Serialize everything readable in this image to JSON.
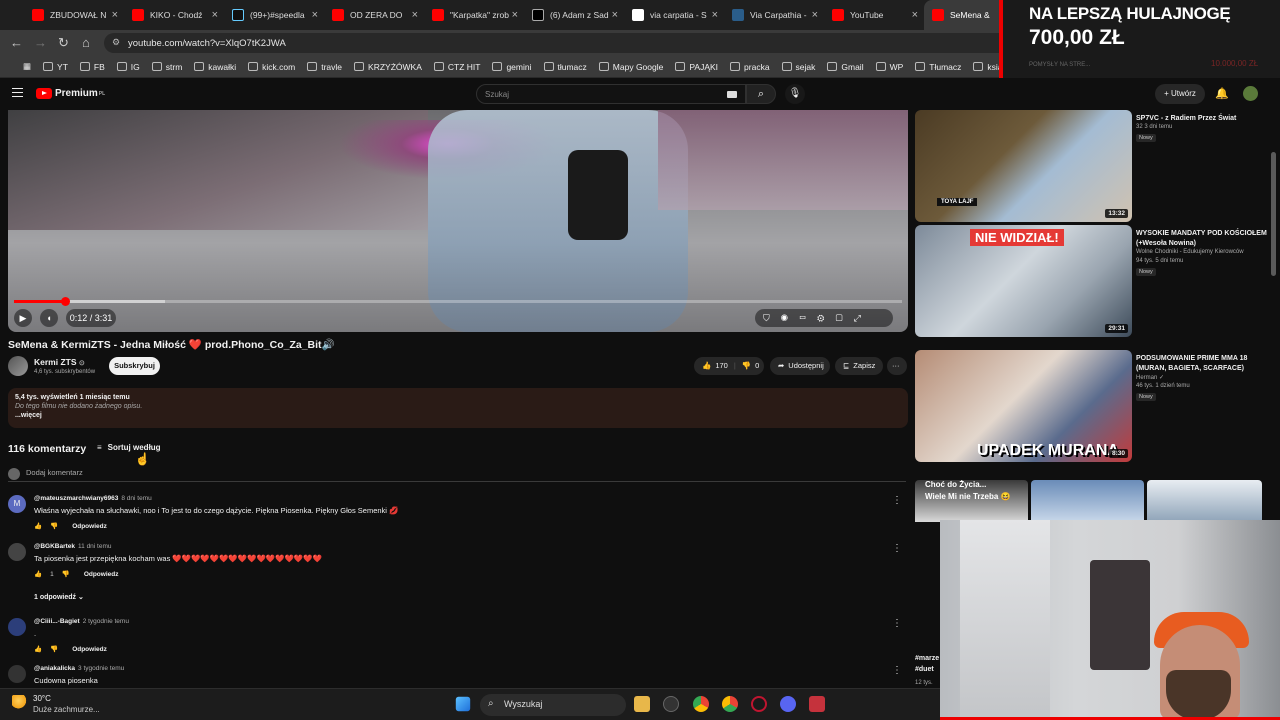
{
  "browser": {
    "tabs": [
      {
        "label": "ZBUDOWAŁ N",
        "icon": "youtube"
      },
      {
        "label": "KIKO - Chodź",
        "icon": "youtube"
      },
      {
        "label": "(99+)#speedla",
        "icon": "tiktok"
      },
      {
        "label": "OD ZERA DO",
        "icon": "youtube"
      },
      {
        "label": "\"Karpatka\" zrob",
        "icon": "youtube"
      },
      {
        "label": "(6) Adam z Sad",
        "icon": "x"
      },
      {
        "label": "via carpatia - S",
        "icon": "google"
      },
      {
        "label": "Via Carpathia -",
        "icon": "globe"
      },
      {
        "label": "YouTube",
        "icon": "youtube"
      },
      {
        "label": "SeMena &",
        "icon": "youtube",
        "active": true
      }
    ],
    "url": "youtube.com/watch?v=XlqO7tK2JWA",
    "bookmarks": [
      "YT",
      "FB",
      "IG",
      "strm",
      "kawałki",
      "kick.com",
      "travle",
      "KRZYŻÓWKA",
      "CTZ HIT",
      "gemini",
      "tłumacz",
      "Mapy Google",
      "PAJĄKI",
      "pracka",
      "sejak",
      "Gmail",
      "WP",
      "Tłumacz",
      "ksiazka"
    ],
    "bookmark_overflow": "POMYSŁY NA STRE..."
  },
  "overlay_ad": {
    "line1": "NA LEPSZĄ HULAJNOGĘ",
    "line2": "700,00 ZŁ",
    "faint_amount": "10.000,00 ZŁ"
  },
  "youtube": {
    "logo": "Premium",
    "logo_region": "PL",
    "search_placeholder": "Szukaj",
    "create_label": "Utwórz"
  },
  "video": {
    "time_current": "0:12",
    "time_total": "3:31",
    "time_display": "0:12 / 3:31",
    "progress_fraction": 0.057,
    "buffer_fraction": 0.17,
    "title": "SeMena & KermiZTS - Jedna Miłość ❤️ prod.Phono_Co_Za_Bit🔊",
    "channel": "Kermi ZTS",
    "subscribers": "4,6 tys. subskrybentów",
    "subscribe_label": "Subskrybuj",
    "likes": "170",
    "dislikes": "0",
    "share_label": "Udostępnij",
    "save_label": "Zapisz",
    "views_meta": "5,4 tys. wyświetleń  1 miesiąc temu",
    "no_description": "Do tego filmu nie dodano żadnego opisu.",
    "more_label": "...więcej"
  },
  "comments": {
    "count_label": "116 komentarzy",
    "sort_label": "Sortuj według",
    "add_placeholder": "Dodaj komentarz",
    "reply_label": "Odpowiedz",
    "items": [
      {
        "author": "@mateuszmarchwiany6963",
        "time": "8 dni temu",
        "text": "Właśna wyjechała na słuchawki, noo i To jest to do czego dążycie. Piękna Piosenka. Piękny Głos Semenki 💋",
        "likes": "",
        "avatar_letter": "M",
        "avatar_color": "#5c6bc0"
      },
      {
        "author": "@BGKBartek",
        "time": "11 dni temu",
        "text": "Ta piosenka jest przepiękna kocham was ❤️❤️❤️❤️❤️❤️❤️❤️❤️❤️❤️❤️❤️❤️❤️❤️",
        "likes": "1",
        "avatar_letter": "",
        "avatar_color": "#444444",
        "replies": "1 odpowiedź"
      },
      {
        "author": "@Ciiii...-Bagiet",
        "time": "2 tygodnie temu",
        "text": ".",
        "likes": "",
        "avatar_letter": "",
        "avatar_color": "#2c3e7a"
      },
      {
        "author": "@aniakalicka",
        "time": "3 tygodnie temu",
        "text": "Cudowna piosenka",
        "likes": "",
        "avatar_letter": "",
        "avatar_color": "#333333"
      }
    ]
  },
  "sidebar": {
    "items": [
      {
        "title": "SP7VC - z Radiem Przez Świat",
        "channel": "",
        "views": "32  3 dni temu",
        "badge": "Nowy",
        "duration": "13:32",
        "thumb_text": "TOYA LAJF"
      },
      {
        "title": "WYSOKIE MANDATY POD KOŚCIOŁEM (+Wesoła Nowina)",
        "channel": "Wolne Chodniki - Edukujemy Kierowców",
        "views": "94 tys.  5 dni temu",
        "badge": "Nowy",
        "duration": "29:31",
        "thumb_text": "NIE WIDZIAŁ!"
      },
      {
        "title": "PODSUMOWANIE PRIME MMA 18 (MURAN, BAGIETA, SCARFACE)",
        "channel": "Herman ✓",
        "views": "46 tys.  1 dzień temu",
        "badge": "Nowy",
        "duration": "8:30",
        "thumb_text": "UPADEK MURANA"
      }
    ],
    "shorts": [
      {
        "caption": "Choć do Życia...",
        "sub": "Wiele Mi nie Trzeba 😆"
      },
      {
        "caption": "#marze",
        "sub": "#duet"
      }
    ],
    "shorts_views": "12 tys."
  },
  "taskbar": {
    "temperature": "30°C",
    "weather": "Duże zachmurze...",
    "search_label": "Wyszukaj"
  }
}
